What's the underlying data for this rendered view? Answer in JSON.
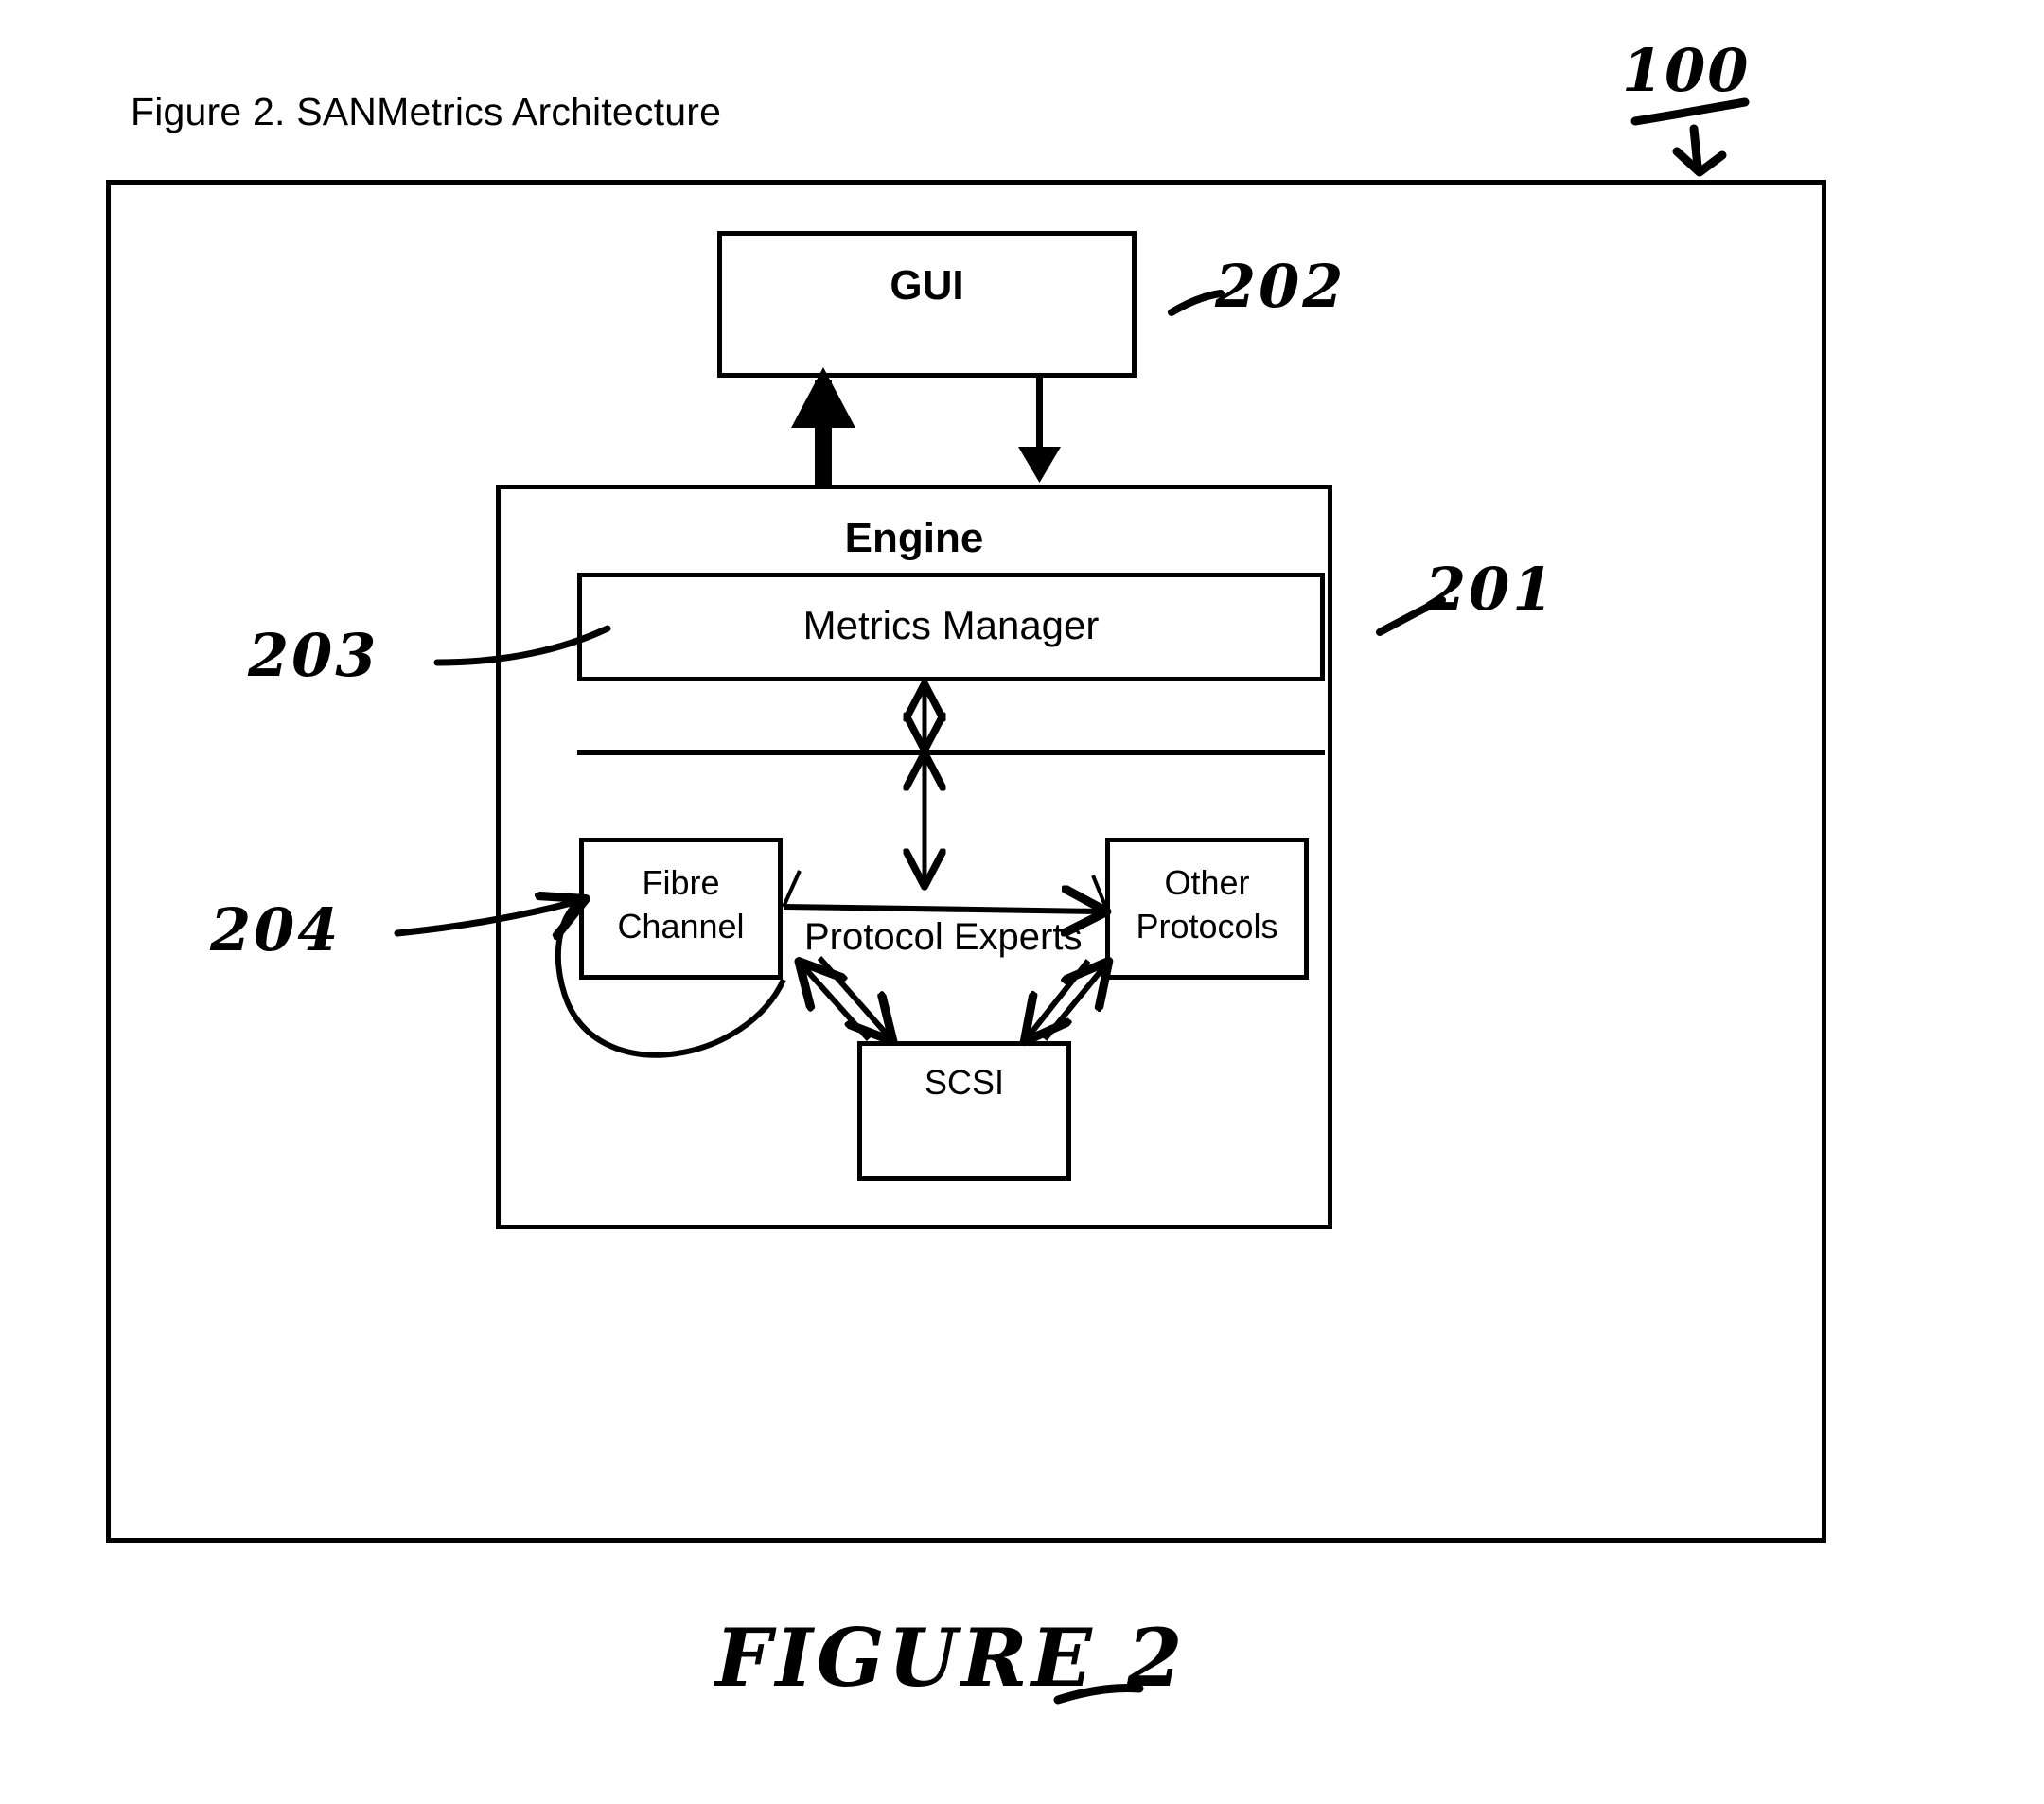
{
  "document": {
    "caption": "Figure 2. SANMetrics Architecture",
    "bottom_handwritten_caption": "FIGURE 2"
  },
  "diagram": {
    "title": "SANMetrics Architecture",
    "nodes": {
      "gui": {
        "label": "GUI"
      },
      "engine": {
        "label": "Engine"
      },
      "metrics_manager": {
        "label": "Metrics Manager"
      },
      "fibre_channel": {
        "label_line1": "Fibre",
        "label_line2": "Channel"
      },
      "other_protocols": {
        "label_line1": "Other",
        "label_line2": "Protocols"
      },
      "scsi": {
        "label": "SCSI"
      },
      "protocol_experts": {
        "label": "Protocol Experts"
      }
    },
    "reference_numerals": {
      "figure_number": "100",
      "gui": "202",
      "engine": "201",
      "metrics_manager": "203",
      "protocol_experts": "204"
    },
    "colors": {
      "ink": "#000000",
      "paper": "#ffffff"
    }
  },
  "chart_data": {
    "type": "diagram",
    "title": "Figure 2. SANMetrics Architecture",
    "blocks": [
      {
        "id": "gui",
        "label": "GUI",
        "numeral": "202",
        "parent": null
      },
      {
        "id": "engine",
        "label": "Engine",
        "numeral": "201",
        "parent": null
      },
      {
        "id": "metrics_manager",
        "label": "Metrics Manager",
        "numeral": "203",
        "parent": "engine"
      },
      {
        "id": "protocol_experts",
        "label": "Protocol Experts",
        "numeral": "204",
        "parent": "engine"
      },
      {
        "id": "fibre_channel",
        "label": "Fibre Channel",
        "numeral": "",
        "parent": "protocol_experts"
      },
      {
        "id": "other_protocols",
        "label": "Other Protocols",
        "numeral": "",
        "parent": "protocol_experts"
      },
      {
        "id": "scsi",
        "label": "SCSI",
        "numeral": "",
        "parent": "protocol_experts"
      }
    ],
    "edges": [
      {
        "from": "engine",
        "to": "gui",
        "style": "thick-solid",
        "arrow": "single"
      },
      {
        "from": "gui",
        "to": "engine",
        "style": "thin-solid",
        "arrow": "single"
      },
      {
        "from": "metrics_manager",
        "to": "divider",
        "style": "thin-solid",
        "arrow": "double"
      },
      {
        "from": "divider",
        "to": "protocol_experts",
        "style": "thin-solid",
        "arrow": "double"
      },
      {
        "from": "fibre_channel",
        "to": "other_protocols",
        "style": "thin-solid",
        "arrow": "single"
      },
      {
        "from": "scsi",
        "to": "fibre_channel",
        "style": "thin-solid",
        "arrow": "single"
      },
      {
        "from": "fibre_channel",
        "to": "scsi",
        "style": "thin-solid",
        "arrow": "single"
      },
      {
        "from": "scsi",
        "to": "other_protocols",
        "style": "thin-solid",
        "arrow": "single"
      },
      {
        "from": "other_protocols",
        "to": "scsi",
        "style": "thin-solid",
        "arrow": "single"
      },
      {
        "from": "fibre_channel",
        "to": "fibre_channel",
        "style": "curved-loop",
        "arrow": "single"
      }
    ]
  }
}
